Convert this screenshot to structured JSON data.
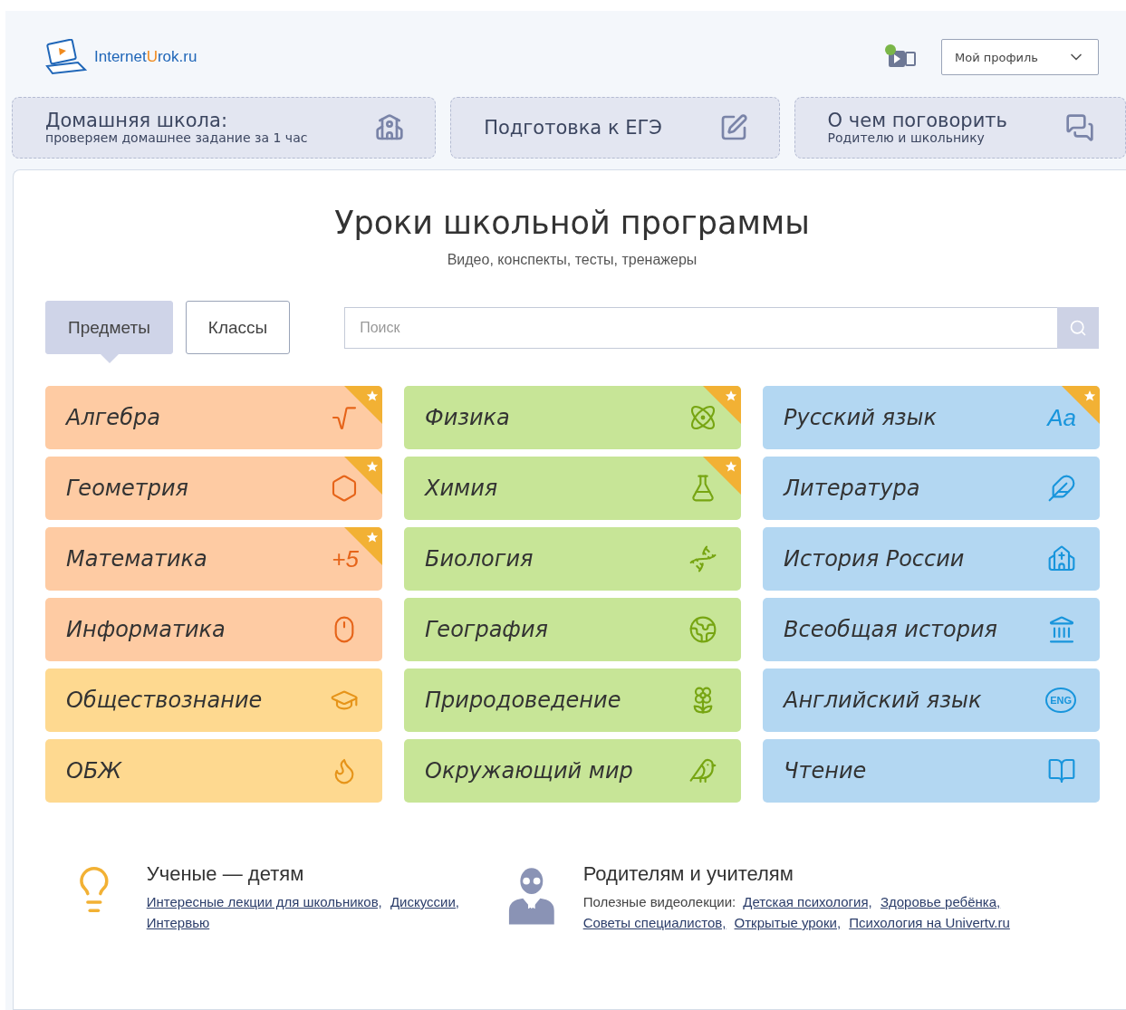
{
  "header": {
    "logo": {
      "before": "Internet",
      "accent": "U",
      "after": "rok.ru"
    },
    "video_alert": true,
    "profile": "Мой профиль"
  },
  "nav": [
    {
      "title": "Домашняя школа:",
      "subtitle": "проверяем домашнее задание за 1 час"
    },
    {
      "title": "Подготовка к ЕГЭ"
    },
    {
      "title": "О чем поговорить",
      "subtitle": "Родителю и школьнику"
    }
  ],
  "heading": "Уроки школьной программы",
  "subheading": "Видео, конспекты, тесты, тренажеры",
  "tabs": [
    {
      "label": "Предметы",
      "selected": true
    },
    {
      "label": "Классы",
      "selected": false
    }
  ],
  "search": {
    "placeholder": "Поиск"
  },
  "columns": [
    {
      "subjects": [
        {
          "name": "Алгебра",
          "color": "#fecba3",
          "starred": true
        },
        {
          "name": "Геометрия",
          "color": "#fecba3",
          "starred": true
        },
        {
          "name": "Математика",
          "color": "#fecba3",
          "starred": true,
          "icon_text": "+5",
          "kind": "text"
        },
        {
          "name": "Информатика",
          "color": "#fecba3",
          "starred": false
        },
        {
          "name": "Обществознание",
          "color": "#fed990",
          "starred": false
        },
        {
          "name": "ОБЖ",
          "color": "#fed990",
          "starred": false
        }
      ]
    },
    {
      "subjects": [
        {
          "name": "Физика",
          "color": "#c7e597",
          "starred": true
        },
        {
          "name": "Химия",
          "color": "#c7e597",
          "starred": true
        },
        {
          "name": "Биология",
          "color": "#c7e597",
          "starred": false
        },
        {
          "name": "География",
          "color": "#c7e597",
          "starred": false
        },
        {
          "name": "Природоведение",
          "color": "#c7e597",
          "starred": false
        },
        {
          "name": "Окружающий мир",
          "color": "#c7e597",
          "starred": false
        }
      ]
    },
    {
      "subjects": [
        {
          "name": "Русский язык",
          "color": "#b3d7f2",
          "starred": true,
          "icon_text": "Aa",
          "kind": "text"
        },
        {
          "name": "Литература",
          "color": "#b3d7f2",
          "starred": false
        },
        {
          "name": "История России",
          "color": "#b3d7f2",
          "starred": false
        },
        {
          "name": "Всеобщая история",
          "color": "#b3d7f2",
          "starred": false
        },
        {
          "name": "Английский язык",
          "color": "#b3d7f2",
          "starred": false,
          "icon_text": "ENG",
          "kind": "bubble"
        },
        {
          "name": "Чтение",
          "color": "#b3d7f2",
          "starred": false
        }
      ]
    }
  ],
  "promos": [
    {
      "title": "Ученые — детям",
      "links": [
        "Интересные лекции для школьников,",
        "Дискуссии,",
        "Интервью"
      ]
    },
    {
      "title": "Родителям и учителям",
      "prefix": "Полезные видеолекции:",
      "links": [
        "Детская психология,",
        "Здоровье ребёнка,",
        "Советы специалистов,",
        "Открытые уроки,",
        "Психология на Univertv.ru"
      ]
    }
  ]
}
